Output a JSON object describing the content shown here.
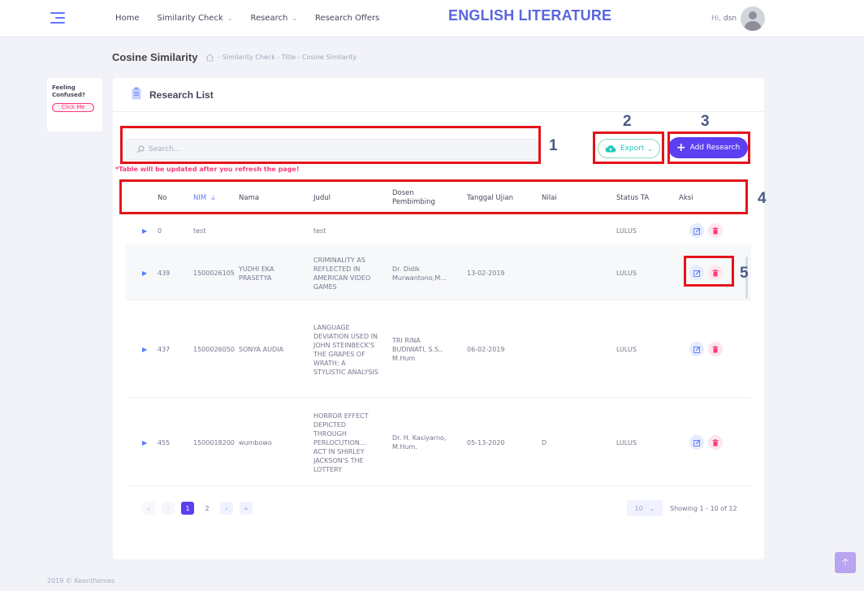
{
  "header": {
    "nav": [
      {
        "label": "Home",
        "has_dropdown": false
      },
      {
        "label": "Similarity Check",
        "has_dropdown": true
      },
      {
        "label": "Research",
        "has_dropdown": true
      },
      {
        "label": "Research Offers",
        "has_dropdown": false
      }
    ],
    "brand": "ENGLISH LITERATURE",
    "greeting": "Hi,",
    "username": "dsn"
  },
  "subheader": {
    "title": "Cosine Similarity",
    "breadcrumb": "- Similarity Check - Title - Cosine Similarity"
  },
  "help": {
    "text": "Feeling Confused?",
    "button": "Click Me"
  },
  "card": {
    "title": "Research List",
    "search_placeholder": "Search...",
    "warning": "*Table will be updated after you refresh the page!",
    "export_label": "Export",
    "add_label": "Add Research"
  },
  "annotations": [
    "1",
    "2",
    "3",
    "4",
    "5"
  ],
  "table": {
    "columns": [
      "No",
      "NIM",
      "Nama",
      "Judul",
      "Dosen Pembimbing",
      "Tanggal Ujian",
      "Nilai",
      "Status TA",
      "Aksi"
    ],
    "sorted_column": "NIM",
    "rows": [
      {
        "no": "0",
        "nim": "test",
        "nama": "",
        "judul": "test",
        "dosen": "",
        "tanggal": "",
        "nilai": "",
        "status": "LULUS"
      },
      {
        "no": "439",
        "nim": "1500026105",
        "nama": "YUDHI EKA PRASETYA",
        "judul": "CRIMINALITY AS REFLECTED IN AMERICAN VIDEO GAMES",
        "dosen": "Dr. Didik Murwantono,M...",
        "tanggal": "13-02-2019",
        "nilai": "",
        "status": "LULUS"
      },
      {
        "no": "437",
        "nim": "1500026050",
        "nama": "SONYA AUDIA",
        "judul": "LANGUAGE DEVIATION USED IN JOHN STEINBECK'S THE GRAPES OF WRATH: A STYLISTIC ANALYSIS",
        "dosen": "TRI RINA BUDIWATI, S.S., M.Hum",
        "tanggal": "06-02-2019",
        "nilai": "",
        "status": "LULUS"
      },
      {
        "no": "455",
        "nim": "1500018200",
        "nama": "wumbowo",
        "judul": "HORROR EFFECT DEPICTED THROUGH PERLOCUTION... ACT IN SHIRLEY JACKSON'S THE LOTTERY",
        "dosen": "Dr. H. Kasiyarno, M.Hum.",
        "tanggal": "05-13-2020",
        "nilai": "D",
        "status": "LULUS"
      }
    ]
  },
  "pagination": {
    "pages": [
      "1",
      "2"
    ],
    "current_page": "1",
    "per_page": "10",
    "showing": "Showing 1 - 10 of 12"
  },
  "footer": "2019 © Keenthemes",
  "colors": {
    "primary": "#5d3ff2",
    "accent": "#5d78ff",
    "success": "#1dc9b7",
    "danger": "#fd397a",
    "annotation": "#e3141a"
  }
}
